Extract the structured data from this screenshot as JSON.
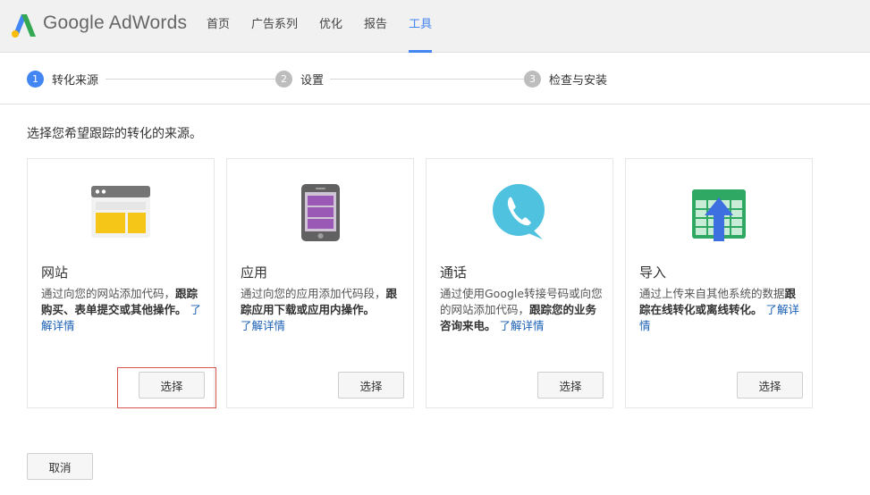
{
  "header": {
    "brand": "Google AdWords",
    "nav": [
      {
        "label": "首页",
        "active": false
      },
      {
        "label": "广告系列",
        "active": false
      },
      {
        "label": "优化",
        "active": false
      },
      {
        "label": "报告",
        "active": false
      },
      {
        "label": "工具",
        "active": true
      }
    ]
  },
  "stepper": {
    "steps": [
      {
        "number": "1",
        "label": "转化来源",
        "active": true
      },
      {
        "number": "2",
        "label": "设置",
        "active": false
      },
      {
        "number": "3",
        "label": "检查与安装",
        "active": false
      }
    ]
  },
  "intro": "选择您希望跟踪的转化的来源。",
  "cards": [
    {
      "title": "网站",
      "desc_plain": "通过向您的网站添加代码，",
      "desc_bold": "跟踪购买、表单提交或其他操作。",
      "link": "了解详情",
      "icon": "website-icon",
      "button": "选择"
    },
    {
      "title": "应用",
      "desc_plain": "通过向您的应用添加代码段，",
      "desc_bold": "跟踪应用下载或应用内操作。",
      "link": "了解详情",
      "icon": "mobile-app-icon",
      "button": "选择"
    },
    {
      "title": "通话",
      "desc_plain": "通过使用Google转接号码或向您的网站添加代码，",
      "desc_bold": "跟踪您的业务咨询来电。",
      "link": "了解详情",
      "icon": "phone-call-icon",
      "button": "选择"
    },
    {
      "title": "导入",
      "desc_plain": "通过上传来自其他系统的数据",
      "desc_bold": "跟踪在线转化或离线转化。",
      "link": "了解详情",
      "icon": "import-spreadsheet-icon",
      "button": "选择"
    }
  ],
  "cancel": "取消",
  "colors": {
    "accent": "#4285f4",
    "highlight": "#d9534f"
  }
}
